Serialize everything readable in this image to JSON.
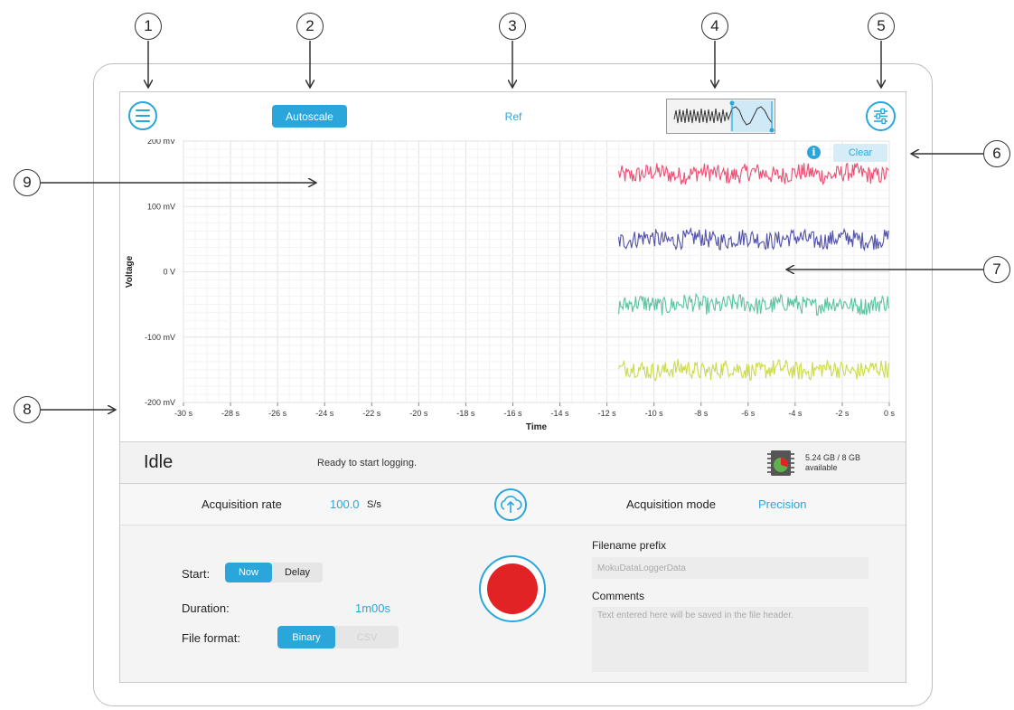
{
  "callouts": [
    "1",
    "2",
    "3",
    "4",
    "5",
    "6",
    "7",
    "8",
    "9"
  ],
  "toolbar": {
    "menu_icon": "hamburger-menu-icon",
    "autoscale_label": "Autoscale",
    "ref_label": "Ref",
    "preview_icon": "waveform-overview-icon",
    "settings_icon": "sliders-settings-icon"
  },
  "plot": {
    "info_label": "i",
    "clear_label": "Clear"
  },
  "chart_data": {
    "type": "line",
    "xlabel": "Time",
    "ylabel": "Voltage",
    "xlim": [
      -30,
      0
    ],
    "ylim": [
      -200,
      200
    ],
    "x_ticks": [
      "-30 s",
      "-28 s",
      "-26 s",
      "-24 s",
      "-22 s",
      "-20 s",
      "-18 s",
      "-16 s",
      "-14 s",
      "-12 s",
      "-10 s",
      "-8 s",
      "-6 s",
      "-4 s",
      "-2 s",
      "0 s"
    ],
    "y_ticks": [
      "200 mV",
      "100 mV",
      "0 V",
      "-100 mV",
      "-200 mV"
    ],
    "grid": true,
    "series": [
      {
        "color": "#e8305c",
        "x_start": -11.5,
        "x_end": 0,
        "mean": 150,
        "noise": 14
      },
      {
        "color": "#34339a",
        "x_start": -11.5,
        "x_end": 0,
        "mean": 50,
        "noise": 14
      },
      {
        "color": "#3cba8e",
        "x_start": -11.5,
        "x_end": 0,
        "mean": -50,
        "noise": 14
      },
      {
        "color": "#c4d32b",
        "x_start": -11.5,
        "x_end": 0,
        "mean": -150,
        "noise": 14
      }
    ]
  },
  "status": {
    "state": "Idle",
    "message": "Ready to start logging.",
    "storage_icon": "sd-card-storage-icon",
    "storage_line1": "5.24 GB / 8 GB",
    "storage_line2": "available"
  },
  "acquisition": {
    "rate_label": "Acquisition rate",
    "rate_value": "100.0",
    "rate_unit": "S/s",
    "upload_icon": "cloud-upload-icon",
    "mode_label": "Acquisition mode",
    "mode_value": "Precision"
  },
  "controls": {
    "start_label": "Start:",
    "start_options": [
      "Now",
      "Delay"
    ],
    "duration_label": "Duration:",
    "duration_value": "1m00s",
    "format_label": "File format:",
    "format_options": [
      "Binary",
      "CSV"
    ],
    "record_icon": "record-icon",
    "filename_label": "Filename prefix",
    "filename_placeholder": "MokuDataLoggerData",
    "comments_label": "Comments",
    "comments_placeholder": "Text entered here will be saved in the file header."
  }
}
